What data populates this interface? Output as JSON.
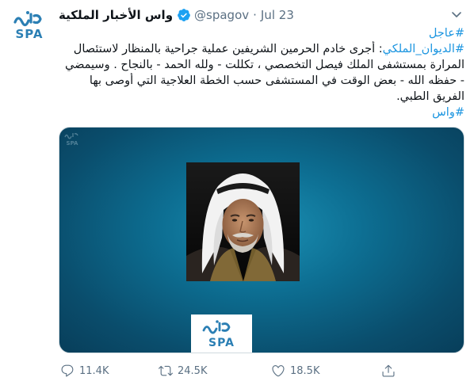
{
  "tweet": {
    "account_name": "واس الأخبار الملكية",
    "handle": "@spagov",
    "separator": "·",
    "date": "Jul 23",
    "body_lines": [
      {
        "prefix": "",
        "hashtag": "#عاجل",
        "rest": ""
      },
      {
        "prefix": "",
        "hashtag": "#الديوان_الملكي",
        "rest": ": أجرى خادم الحرمين الشريفين عملية جراحية بالمنظار لاستئصال"
      },
      {
        "prefix": "",
        "hashtag": "",
        "rest": "المرارة بمستشفى الملك فيصل التخصصي ، تكللت - ولله الحمد - بالنجاح . وسيمضي"
      },
      {
        "prefix": "",
        "hashtag": "",
        "rest": "- حفظه الله - بعض الوقت في المستشفى حسب الخطة العلاجية التي أوصى بها"
      },
      {
        "prefix": "",
        "hashtag": "",
        "rest": "الفريق الطبي."
      },
      {
        "prefix": "",
        "hashtag": "#واس",
        "rest": ""
      }
    ],
    "media_logo": {
      "line1": "واس",
      "line2": "SPA"
    },
    "actions": {
      "reply_count": "11.4K",
      "retweet_count": "24.5K",
      "like_count": "18.5K"
    }
  },
  "colors": {
    "link": "#1b95e0",
    "secondary_text": "#5b7083",
    "brand_teal": "#0a6d8f",
    "spa_blue": "#2b7fb4"
  }
}
